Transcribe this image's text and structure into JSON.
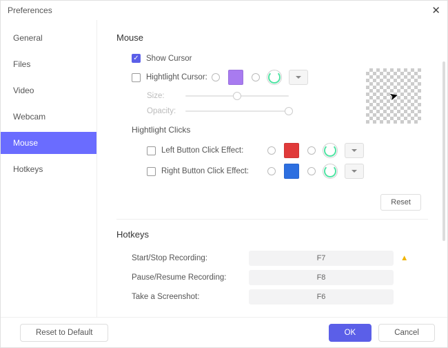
{
  "titlebar": {
    "title": "Preferences"
  },
  "sidebar": {
    "items": [
      {
        "label": "General"
      },
      {
        "label": "Files"
      },
      {
        "label": "Video"
      },
      {
        "label": "Webcam"
      },
      {
        "label": "Mouse"
      },
      {
        "label": "Hotkeys"
      }
    ],
    "active_index": 4
  },
  "mouse": {
    "heading": "Mouse",
    "show_cursor": {
      "label": "Show Cursor",
      "checked": true
    },
    "highlight_cursor": {
      "label": "Hightlight Cursor:",
      "checked": false,
      "solid_color": "#a87bf0",
      "spinner_selected": true
    },
    "size_label": "Size:",
    "size_value": 50,
    "opacity_label": "Opacity:",
    "opacity_value": 100,
    "clicks_heading": "Hightlight Clicks",
    "left_click": {
      "label": "Left Button Click Effect:",
      "checked": false,
      "color": "#e03a3a"
    },
    "right_click": {
      "label": "Right Button Click Effect:",
      "checked": false,
      "color": "#2d6fe0"
    },
    "reset_label": "Reset"
  },
  "hotkeys": {
    "heading": "Hotkeys",
    "rows": [
      {
        "label": "Start/Stop Recording:",
        "key": "F7",
        "warn": true
      },
      {
        "label": "Pause/Resume Recording:",
        "key": "F8",
        "warn": false
      },
      {
        "label": "Take a Screenshot:",
        "key": "F6",
        "warn": false
      }
    ]
  },
  "footer": {
    "reset_default": "Reset to Default",
    "ok": "OK",
    "cancel": "Cancel"
  }
}
